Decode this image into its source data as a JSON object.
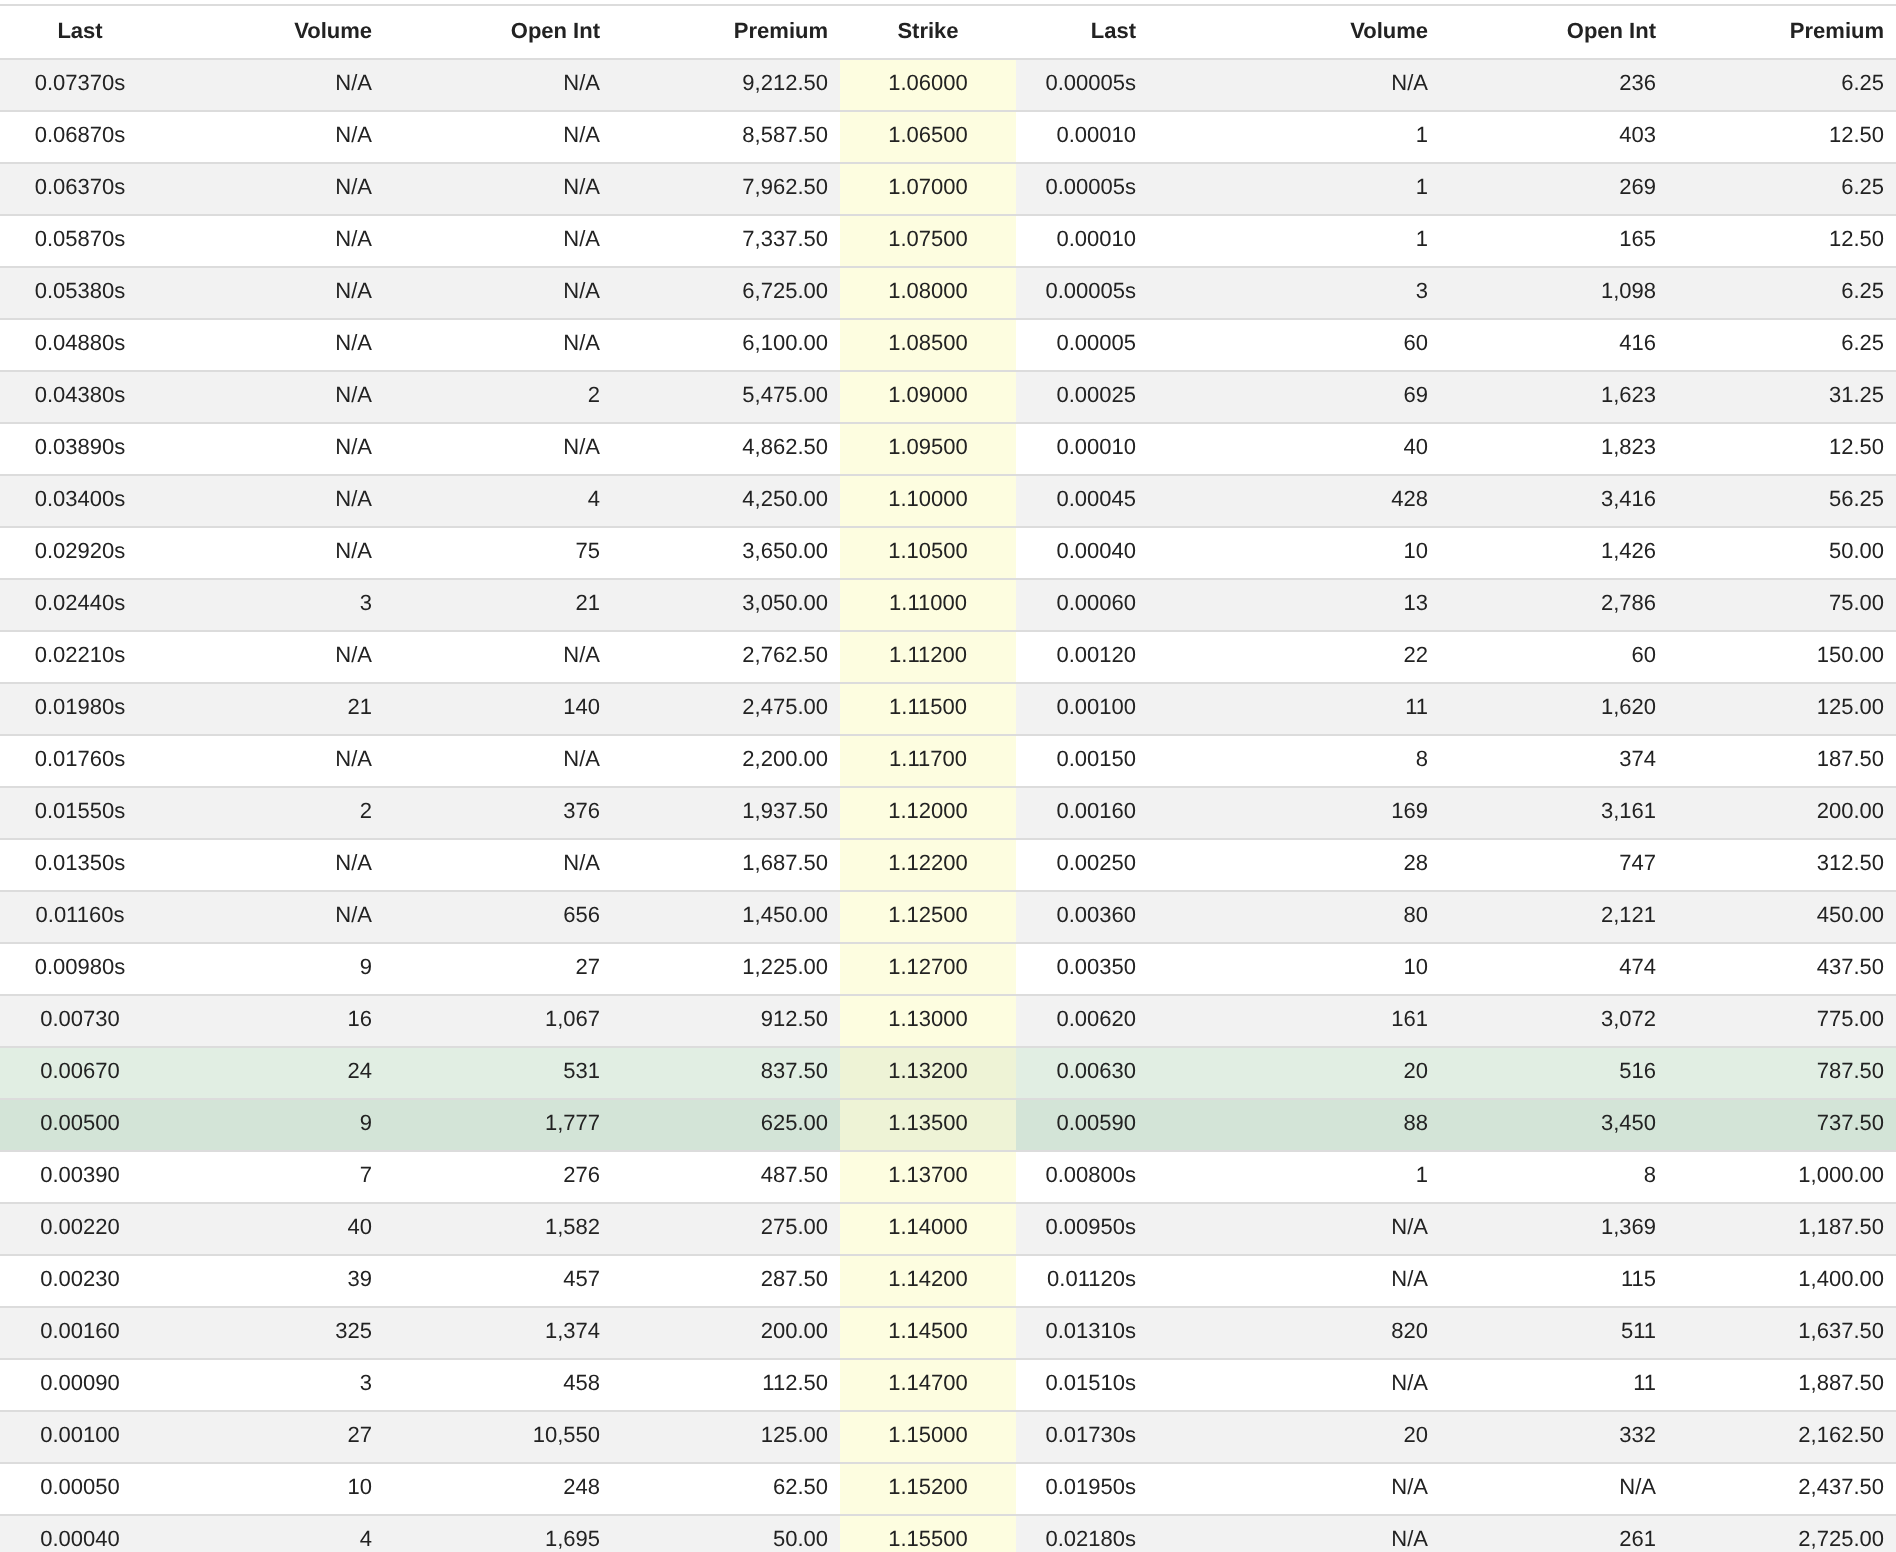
{
  "columns": [
    "Last",
    "Volume",
    "Open Int",
    "Premium",
    "Strike",
    "Last",
    "Volume",
    "Open Int",
    "Premium"
  ],
  "rows": [
    {
      "highlight": false,
      "selected": false,
      "cells": [
        "0.07370s",
        "N/A",
        "N/A",
        "9,212.50",
        "1.06000",
        "0.00005s",
        "N/A",
        "236",
        "6.25"
      ]
    },
    {
      "highlight": false,
      "selected": false,
      "cells": [
        "0.06870s",
        "N/A",
        "N/A",
        "8,587.50",
        "1.06500",
        "0.00010",
        "1",
        "403",
        "12.50"
      ]
    },
    {
      "highlight": false,
      "selected": false,
      "cells": [
        "0.06370s",
        "N/A",
        "N/A",
        "7,962.50",
        "1.07000",
        "0.00005s",
        "1",
        "269",
        "6.25"
      ]
    },
    {
      "highlight": false,
      "selected": false,
      "cells": [
        "0.05870s",
        "N/A",
        "N/A",
        "7,337.50",
        "1.07500",
        "0.00010",
        "1",
        "165",
        "12.50"
      ]
    },
    {
      "highlight": false,
      "selected": false,
      "cells": [
        "0.05380s",
        "N/A",
        "N/A",
        "6,725.00",
        "1.08000",
        "0.00005s",
        "3",
        "1,098",
        "6.25"
      ]
    },
    {
      "highlight": false,
      "selected": false,
      "cells": [
        "0.04880s",
        "N/A",
        "N/A",
        "6,100.00",
        "1.08500",
        "0.00005",
        "60",
        "416",
        "6.25"
      ]
    },
    {
      "highlight": false,
      "selected": false,
      "cells": [
        "0.04380s",
        "N/A",
        "2",
        "5,475.00",
        "1.09000",
        "0.00025",
        "69",
        "1,623",
        "31.25"
      ]
    },
    {
      "highlight": false,
      "selected": false,
      "cells": [
        "0.03890s",
        "N/A",
        "N/A",
        "4,862.50",
        "1.09500",
        "0.00010",
        "40",
        "1,823",
        "12.50"
      ]
    },
    {
      "highlight": false,
      "selected": false,
      "cells": [
        "0.03400s",
        "N/A",
        "4",
        "4,250.00",
        "1.10000",
        "0.00045",
        "428",
        "3,416",
        "56.25"
      ]
    },
    {
      "highlight": false,
      "selected": false,
      "cells": [
        "0.02920s",
        "N/A",
        "75",
        "3,650.00",
        "1.10500",
        "0.00040",
        "10",
        "1,426",
        "50.00"
      ]
    },
    {
      "highlight": false,
      "selected": false,
      "cells": [
        "0.02440s",
        "3",
        "21",
        "3,050.00",
        "1.11000",
        "0.00060",
        "13",
        "2,786",
        "75.00"
      ]
    },
    {
      "highlight": false,
      "selected": false,
      "cells": [
        "0.02210s",
        "N/A",
        "N/A",
        "2,762.50",
        "1.11200",
        "0.00120",
        "22",
        "60",
        "150.00"
      ]
    },
    {
      "highlight": false,
      "selected": false,
      "cells": [
        "0.01980s",
        "21",
        "140",
        "2,475.00",
        "1.11500",
        "0.00100",
        "11",
        "1,620",
        "125.00"
      ]
    },
    {
      "highlight": false,
      "selected": false,
      "cells": [
        "0.01760s",
        "N/A",
        "N/A",
        "2,200.00",
        "1.11700",
        "0.00150",
        "8",
        "374",
        "187.50"
      ]
    },
    {
      "highlight": false,
      "selected": false,
      "cells": [
        "0.01550s",
        "2",
        "376",
        "1,937.50",
        "1.12000",
        "0.00160",
        "169",
        "3,161",
        "200.00"
      ]
    },
    {
      "highlight": false,
      "selected": false,
      "cells": [
        "0.01350s",
        "N/A",
        "N/A",
        "1,687.50",
        "1.12200",
        "0.00250",
        "28",
        "747",
        "312.50"
      ]
    },
    {
      "highlight": false,
      "selected": false,
      "cells": [
        "0.01160s",
        "N/A",
        "656",
        "1,450.00",
        "1.12500",
        "0.00360",
        "80",
        "2,121",
        "450.00"
      ]
    },
    {
      "highlight": false,
      "selected": false,
      "cells": [
        "0.00980s",
        "9",
        "27",
        "1,225.00",
        "1.12700",
        "0.00350",
        "10",
        "474",
        "437.50"
      ]
    },
    {
      "highlight": false,
      "selected": false,
      "cells": [
        "0.00730",
        "16",
        "1,067",
        "912.50",
        "1.13000",
        "0.00620",
        "161",
        "3,072",
        "775.00"
      ]
    },
    {
      "highlight": true,
      "selected": false,
      "cells": [
        "0.00670",
        "24",
        "531",
        "837.50",
        "1.13200",
        "0.00630",
        "20",
        "516",
        "787.50"
      ]
    },
    {
      "highlight": true,
      "selected": true,
      "cells": [
        "0.00500",
        "9",
        "1,777",
        "625.00",
        "1.13500",
        "0.00590",
        "88",
        "3,450",
        "737.50"
      ]
    },
    {
      "highlight": false,
      "selected": false,
      "cells": [
        "0.00390",
        "7",
        "276",
        "487.50",
        "1.13700",
        "0.00800s",
        "1",
        "8",
        "1,000.00"
      ]
    },
    {
      "highlight": false,
      "selected": false,
      "cells": [
        "0.00220",
        "40",
        "1,582",
        "275.00",
        "1.14000",
        "0.00950s",
        "N/A",
        "1,369",
        "1,187.50"
      ]
    },
    {
      "highlight": false,
      "selected": false,
      "cells": [
        "0.00230",
        "39",
        "457",
        "287.50",
        "1.14200",
        "0.01120s",
        "N/A",
        "115",
        "1,400.00"
      ]
    },
    {
      "highlight": false,
      "selected": false,
      "cells": [
        "0.00160",
        "325",
        "1,374",
        "200.00",
        "1.14500",
        "0.01310s",
        "820",
        "511",
        "1,637.50"
      ]
    },
    {
      "highlight": false,
      "selected": false,
      "cells": [
        "0.00090",
        "3",
        "458",
        "112.50",
        "1.14700",
        "0.01510s",
        "N/A",
        "11",
        "1,887.50"
      ]
    },
    {
      "highlight": false,
      "selected": false,
      "cells": [
        "0.00100",
        "27",
        "10,550",
        "125.00",
        "1.15000",
        "0.01730s",
        "20",
        "332",
        "2,162.50"
      ]
    },
    {
      "highlight": false,
      "selected": false,
      "cells": [
        "0.00050",
        "10",
        "248",
        "62.50",
        "1.15200",
        "0.01950s",
        "N/A",
        "N/A",
        "2,437.50"
      ]
    },
    {
      "highlight": false,
      "selected": false,
      "cells": [
        "0.00040",
        "4",
        "1,695",
        "50.00",
        "1.15500",
        "0.02180s",
        "N/A",
        "261",
        "2,725.00"
      ]
    }
  ]
}
